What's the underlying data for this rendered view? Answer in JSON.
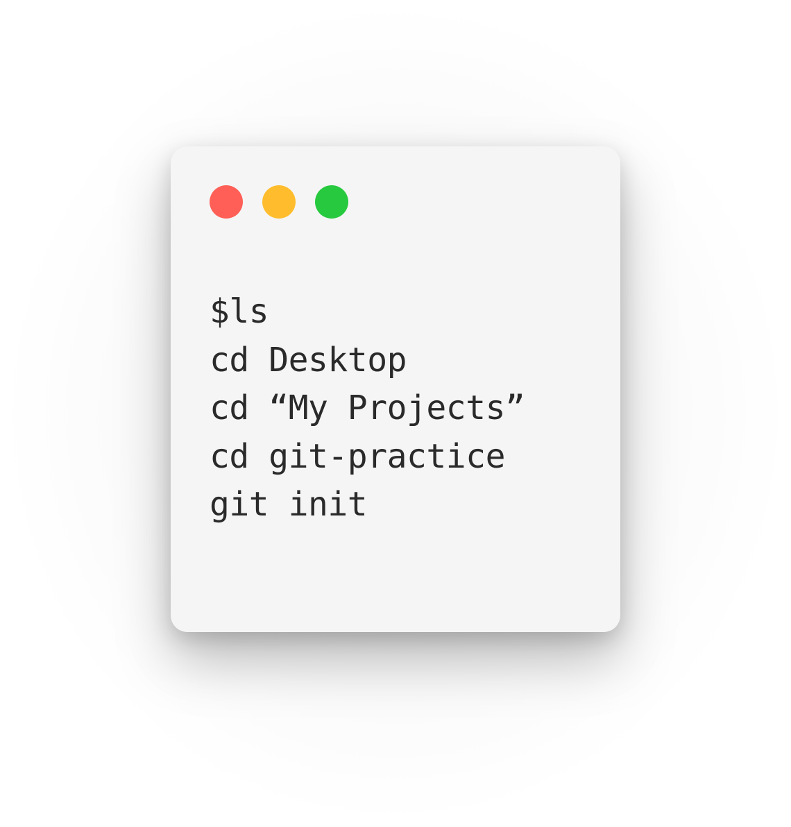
{
  "terminal": {
    "lines": [
      "$ls",
      "cd Desktop",
      "cd “My Projects”",
      "cd git-practice",
      "git init"
    ]
  },
  "colors": {
    "close": "#ff5f56",
    "minimize": "#ffbd2e",
    "maximize": "#27c93f",
    "window_bg": "#f5f5f5",
    "text": "#2a2a2a"
  }
}
